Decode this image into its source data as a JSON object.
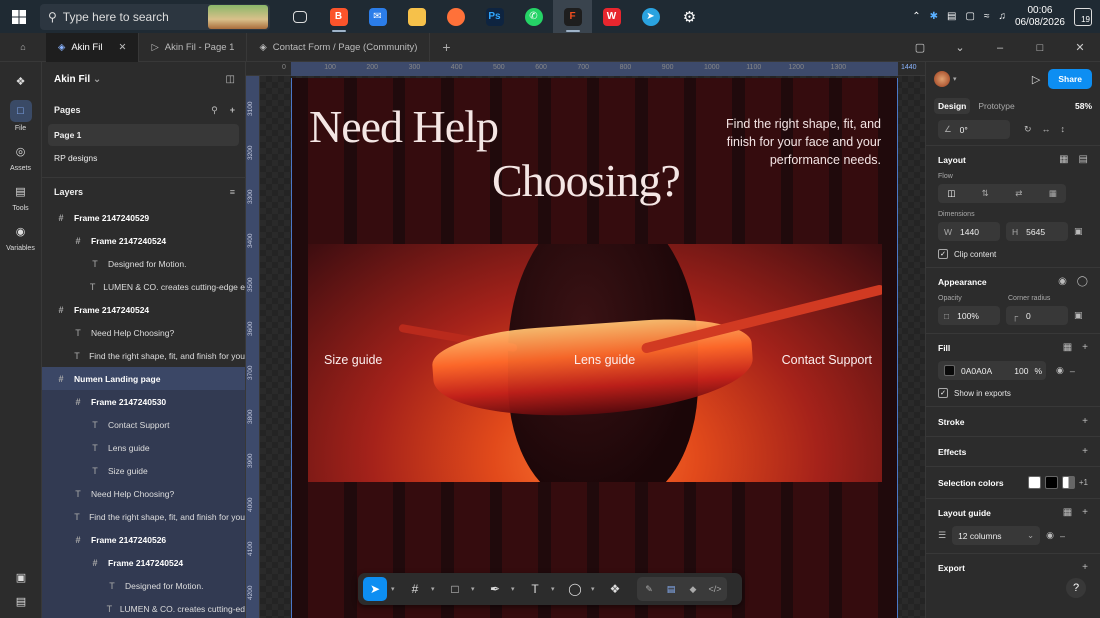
{
  "taskbar": {
    "search_placeholder": "Type here to search",
    "time": "00:06",
    "date": "06/08/2026",
    "notifications": "19"
  },
  "tabs": [
    {
      "label": "Akin Fil",
      "active": true
    },
    {
      "label": "Akin Fil - Page 1",
      "active": false
    },
    {
      "label": "Contact Form / Page (Community)",
      "active": false
    }
  ],
  "rail": {
    "file": "File",
    "assets": "Assets",
    "tools": "Tools",
    "variables": "Variables"
  },
  "layers_panel": {
    "file_name": "Akin Fil",
    "pages_heading": "Pages",
    "pages": [
      "Page 1",
      "RP designs"
    ],
    "layers_heading": "Layers",
    "layers": [
      {
        "label": "Frame 2147240529",
        "indent": 0,
        "icon": "frame-icon",
        "bold": true
      },
      {
        "label": "Frame 2147240524",
        "indent": 1,
        "icon": "frame-icon",
        "bold": true
      },
      {
        "label": "Designed for Motion.",
        "indent": 2,
        "icon": "text-icon"
      },
      {
        "label": "LUMEN & CO. creates cutting-edge e",
        "indent": 2,
        "icon": "text-icon"
      },
      {
        "label": "Frame 2147240524",
        "indent": 0,
        "icon": "frame-icon",
        "bold": true
      },
      {
        "label": "Need Help Choosing?",
        "indent": 1,
        "icon": "text-icon"
      },
      {
        "label": "Find the right shape, fit, and finish for you",
        "indent": 1,
        "icon": "text-icon"
      },
      {
        "label": "Numen Landing page",
        "indent": 0,
        "icon": "frame-icon",
        "bold": true,
        "hl": "hl"
      },
      {
        "label": "Frame 2147240530",
        "indent": 1,
        "icon": "frame-icon",
        "bold": true,
        "hl": "hl2"
      },
      {
        "label": "Contact Support",
        "indent": 2,
        "icon": "text-icon",
        "hl": "hl2"
      },
      {
        "label": "Lens guide",
        "indent": 2,
        "icon": "text-icon",
        "hl": "hl2"
      },
      {
        "label": "Size guide",
        "indent": 2,
        "icon": "text-icon",
        "hl": "hl2"
      },
      {
        "label": "Need Help Choosing?",
        "indent": 1,
        "icon": "text-icon",
        "hl": "hl2"
      },
      {
        "label": "Find the right shape, fit, and finish for you",
        "indent": 1,
        "icon": "text-icon",
        "hl": "hl2"
      },
      {
        "label": "Frame 2147240526",
        "indent": 1,
        "icon": "frame-icon",
        "bold": true,
        "hl": "hl2"
      },
      {
        "label": "Frame 2147240524",
        "indent": 2,
        "icon": "frame-icon",
        "bold": true,
        "hl": "hl2"
      },
      {
        "label": "Designed for Motion.",
        "indent": 3,
        "icon": "text-icon",
        "hl": "hl2"
      },
      {
        "label": "LUMEN & CO. creates cutting-ed",
        "indent": 3,
        "icon": "text-icon",
        "hl": "hl2"
      }
    ]
  },
  "canvas": {
    "ruler_top": [
      "0",
      "100",
      "200",
      "300",
      "400",
      "500",
      "600",
      "700",
      "800",
      "900",
      "1000",
      "1100",
      "1200",
      "1300",
      "1440"
    ],
    "ruler_left": [
      "3100",
      "3200",
      "3300",
      "3400",
      "3500",
      "3600",
      "3700",
      "3800",
      "3900",
      "4000",
      "4100",
      "4200"
    ],
    "hero_title_line1": "Need Help",
    "hero_title_line2": "Choosing?",
    "hero_subtitle": "Find the right shape, fit, and finish for your face and your performance needs.",
    "image_labels": {
      "size": "Size guide",
      "lens": "Lens guide",
      "contact": "Contact Support"
    }
  },
  "properties": {
    "share": "Share",
    "tab_design": "Design",
    "tab_prototype": "Prototype",
    "zoom": "58%",
    "rotation": "0°",
    "layout": {
      "title": "Layout",
      "flow_label": "Flow",
      "dimensions_label": "Dimensions",
      "w_label": "W",
      "w": "1440",
      "h_label": "H",
      "h": "5645",
      "clip": "Clip content"
    },
    "appearance": {
      "title": "Appearance",
      "opacity_label": "Opacity",
      "opacity": "100%",
      "radius_label": "Corner radius",
      "radius": "0"
    },
    "fill": {
      "title": "Fill",
      "hex": "0A0A0A",
      "opacity": "100",
      "percent": "%",
      "color": "#0A0A0A",
      "show_exports": "Show in exports"
    },
    "stroke": "Stroke",
    "effects": "Effects",
    "selection_colors": {
      "title": "Selection colors",
      "more": "+1"
    },
    "layout_guide": {
      "title": "Layout guide",
      "value": "12 columns"
    },
    "export": "Export"
  }
}
